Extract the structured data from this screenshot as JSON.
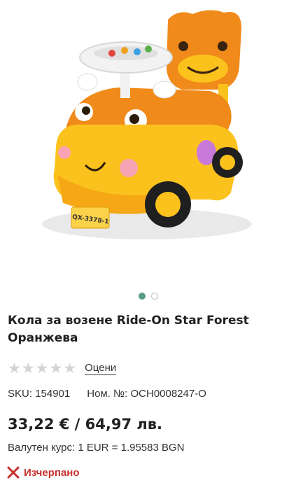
{
  "product": {
    "title_line1": "Кола за возене Ride-On Star Forest",
    "title_line2": "Оранжева",
    "image_plate": "QX-3378-1",
    "rating_link": "Оцени",
    "sku": "SKU: 154901",
    "part_number": "Ном. №: OCH0008247-O",
    "price": "33,22 € / 64,97 лв.",
    "exchange_rate": "Валутен курс: 1 EUR = 1.95583 BGN",
    "stock_status": "Изчерпано",
    "stars": 0
  },
  "gallery": {
    "total": 2,
    "active": 1
  },
  "colors": {
    "accent_dot": "#5a9a8a",
    "out_of_stock": "#c8302c",
    "toy_orange": "#f08a1a",
    "toy_yellow": "#fbc21d"
  }
}
